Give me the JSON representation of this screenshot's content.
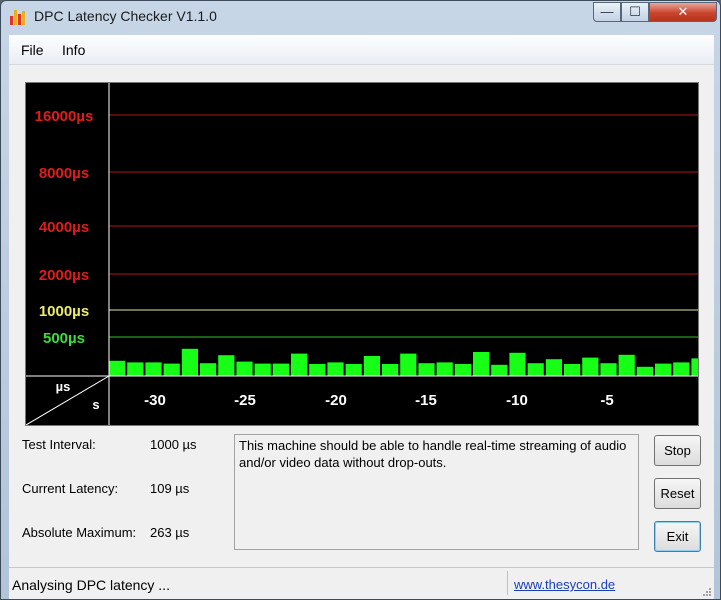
{
  "window": {
    "title": "DPC Latency Checker V1.1.0",
    "controls": {
      "minimize": "—",
      "maximize": "☐",
      "close": "✕"
    }
  },
  "menu": [
    "File",
    "Info"
  ],
  "graph": {
    "y_labels": [
      {
        "text": "16000µs",
        "color": "#e21b1b"
      },
      {
        "text": "8000µs",
        "color": "#e21b1b"
      },
      {
        "text": "4000µs",
        "color": "#e21b1b"
      },
      {
        "text": "2000µs",
        "color": "#e21b1b"
      },
      {
        "text": "1000µs",
        "color": "#ecec6a"
      },
      {
        "text": "500µs",
        "color": "#3bdc3b"
      }
    ],
    "corner_top": "µs",
    "corner_bottom": "s",
    "x_ticks": [
      "-30",
      "-25",
      "-20",
      "-15",
      "-10",
      "-5"
    ],
    "grid_colors": {
      "red": "#b51515",
      "yellow": "#e6e6a6",
      "green": "#2fbf2f",
      "bar": "#17ff17"
    },
    "bar_levels": [
      0.38,
      0.34,
      0.34,
      0.31,
      0.68,
      0.32,
      0.52,
      0.36,
      0.31,
      0.31,
      0.56,
      0.3,
      0.34,
      0.3,
      0.5,
      0.3,
      0.56,
      0.32,
      0.34,
      0.3,
      0.6,
      0.28,
      0.58,
      0.32,
      0.42,
      0.3,
      0.46,
      0.32,
      0.53,
      0.23,
      0.31,
      0.34,
      0.44
    ]
  },
  "stats": [
    {
      "label": "Test Interval:",
      "value": "1000 µs"
    },
    {
      "label": "Current Latency:",
      "value": "109 µs"
    },
    {
      "label": "Absolute Maximum:",
      "value": "263 µs"
    }
  ],
  "message": "This machine should be able to handle real-time streaming of audio and/or video data without drop-outs.",
  "buttons": {
    "stop": "Stop",
    "reset": "Reset",
    "exit": "Exit"
  },
  "status": {
    "text": "Analysing DPC latency ...",
    "link": "www.thesycon.de"
  }
}
